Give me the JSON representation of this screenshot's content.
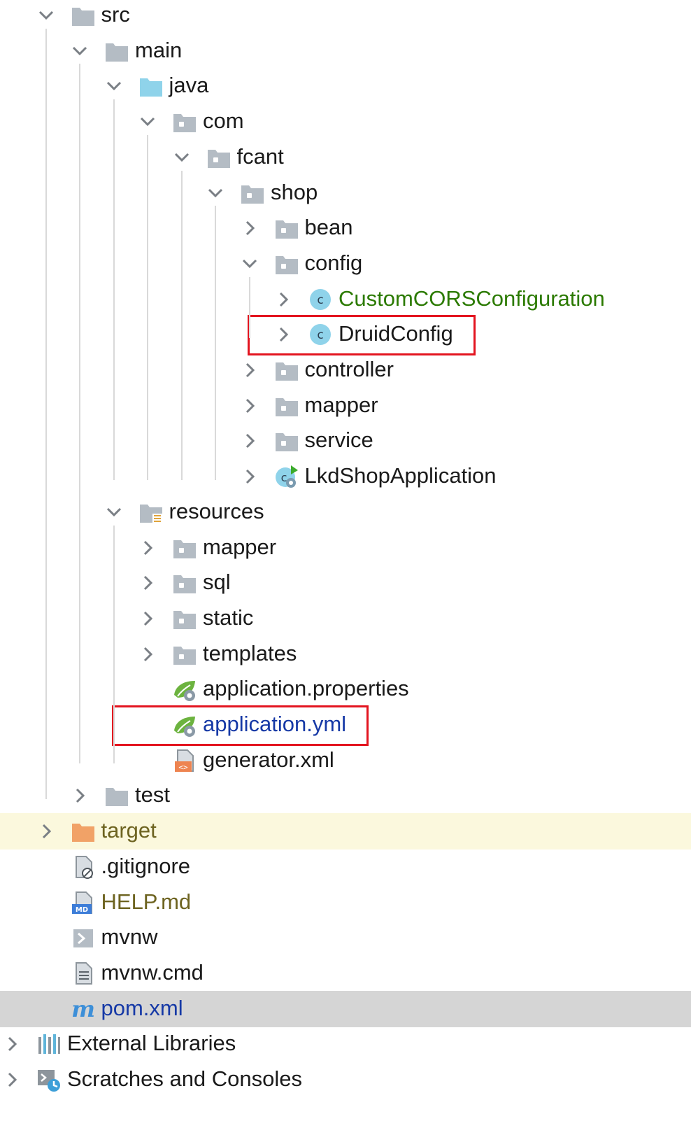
{
  "colors": {
    "default_text": "#1a1a1a",
    "green_text": "#2b7a00",
    "blue_text": "#1639a6",
    "olive_text": "#6d6320",
    "folder_gray": "#b4bcc4",
    "folder_blue": "#8fd3ea",
    "folder_orange": "#f1a267",
    "class_icon": "#8fd3ea",
    "highlight_red": "#e3141f"
  },
  "tree": [
    {
      "label": "src",
      "depth": 1,
      "chevron": "down",
      "icon": "folder-icon"
    },
    {
      "label": "main",
      "depth": 2,
      "chevron": "down",
      "icon": "folder-icon"
    },
    {
      "label": "java",
      "depth": 3,
      "chevron": "down",
      "icon": "source-folder-icon"
    },
    {
      "label": "com",
      "depth": 4,
      "chevron": "down",
      "icon": "package-icon"
    },
    {
      "label": "fcant",
      "depth": 5,
      "chevron": "down",
      "icon": "package-icon"
    },
    {
      "label": "shop",
      "depth": 6,
      "chevron": "down",
      "icon": "package-icon"
    },
    {
      "label": "bean",
      "depth": 7,
      "chevron": "right",
      "icon": "package-icon"
    },
    {
      "label": "config",
      "depth": 7,
      "chevron": "down",
      "icon": "package-icon"
    },
    {
      "label": "CustomCORSConfiguration",
      "depth": 8,
      "chevron": "right",
      "icon": "class-icon",
      "color": "green"
    },
    {
      "label": "DruidConfig",
      "depth": 8,
      "chevron": "right",
      "icon": "class-icon",
      "boxed": true
    },
    {
      "label": "controller",
      "depth": 7,
      "chevron": "right",
      "icon": "package-icon"
    },
    {
      "label": "mapper",
      "depth": 7,
      "chevron": "right",
      "icon": "package-icon"
    },
    {
      "label": "service",
      "depth": 7,
      "chevron": "right",
      "icon": "package-icon"
    },
    {
      "label": "LkdShopApplication",
      "depth": 7,
      "chevron": "right",
      "icon": "spring-boot-class-icon"
    },
    {
      "label": "resources",
      "depth": 3,
      "chevron": "down",
      "icon": "resources-folder-icon"
    },
    {
      "label": "mapper",
      "depth": 4,
      "chevron": "right",
      "icon": "package-icon"
    },
    {
      "label": "sql",
      "depth": 4,
      "chevron": "right",
      "icon": "package-icon"
    },
    {
      "label": "static",
      "depth": 4,
      "chevron": "right",
      "icon": "package-icon"
    },
    {
      "label": "templates",
      "depth": 4,
      "chevron": "right",
      "icon": "package-icon"
    },
    {
      "label": "application.properties",
      "depth": 4,
      "chevron": "none",
      "icon": "spring-config-icon"
    },
    {
      "label": "application.yml",
      "depth": 4,
      "chevron": "none",
      "icon": "spring-config-icon",
      "color": "blue",
      "boxed": true
    },
    {
      "label": "generator.xml",
      "depth": 4,
      "chevron": "none",
      "icon": "xml-file-icon"
    },
    {
      "label": "test",
      "depth": 2,
      "chevron": "right",
      "icon": "folder-icon"
    },
    {
      "label": "target",
      "depth": 1,
      "chevron": "right",
      "icon": "excluded-folder-icon",
      "color": "olive",
      "highlight": "yellow"
    },
    {
      "label": ".gitignore",
      "depth": 1,
      "chevron": "none",
      "icon": "ignored-file-icon"
    },
    {
      "label": "HELP.md",
      "depth": 1,
      "chevron": "none",
      "icon": "markdown-file-icon",
      "color": "olive"
    },
    {
      "label": "mvnw",
      "depth": 1,
      "chevron": "none",
      "icon": "script-file-icon"
    },
    {
      "label": "mvnw.cmd",
      "depth": 1,
      "chevron": "none",
      "icon": "text-file-icon"
    },
    {
      "label": "pom.xml",
      "depth": 1,
      "chevron": "none",
      "icon": "maven-icon",
      "color": "blue",
      "highlight": "gray"
    },
    {
      "label": "External Libraries",
      "depth": 0,
      "chevron": "right",
      "icon": "libraries-icon"
    },
    {
      "label": "Scratches and Consoles",
      "depth": 0,
      "chevron": "right",
      "icon": "scratches-icon"
    }
  ]
}
